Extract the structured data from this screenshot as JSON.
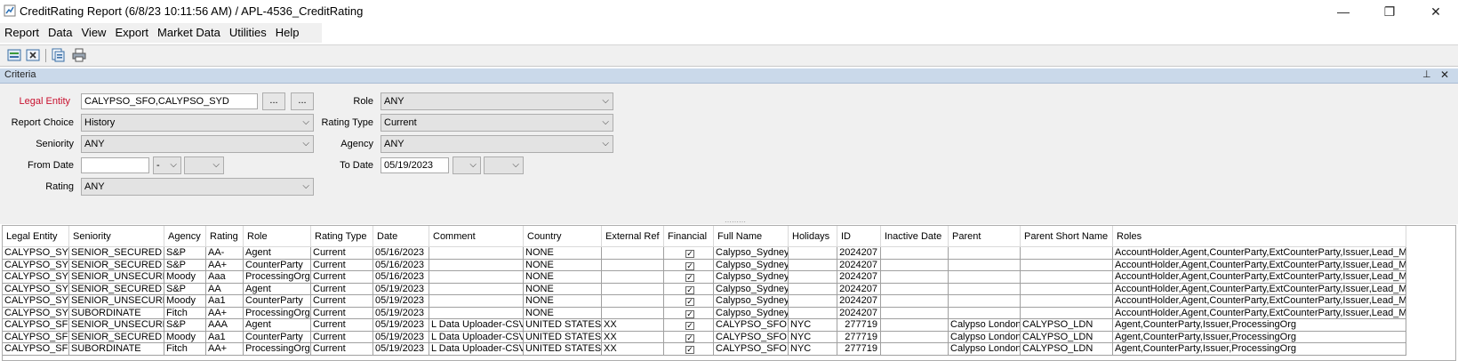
{
  "window": {
    "title": "CreditRating Report (6/8/23 10:11:56 AM) / APL-4536_CreditRating",
    "minimize": "—",
    "maximize": "❐",
    "close": "✕"
  },
  "menu": [
    "Report",
    "Data",
    "View",
    "Export",
    "Market Data",
    "Utilities",
    "Help"
  ],
  "toolbar": {
    "icons": [
      "load-report-icon",
      "clear-report-icon",
      "save-report-icon",
      "print-icon"
    ]
  },
  "criteria": {
    "title": "Criteria",
    "pin": "⊥",
    "close": "✕",
    "legal_entity": {
      "label": "Legal Entity",
      "value": "CALYPSO_SFO,CALYPSO_SYD",
      "btn1": "...",
      "btn2": "..."
    },
    "report_choice": {
      "label": "Report Choice",
      "value": "History"
    },
    "seniority": {
      "label": "Seniority",
      "value": "ANY"
    },
    "from_date": {
      "label": "From Date",
      "value": "",
      "combo1": "-",
      "combo2": ""
    },
    "rating": {
      "label": "Rating",
      "value": "ANY"
    },
    "role": {
      "label": "Role",
      "value": "ANY"
    },
    "rating_type": {
      "label": "Rating Type",
      "value": "Current"
    },
    "agency": {
      "label": "Agency",
      "value": "ANY"
    },
    "to_date": {
      "label": "To Date",
      "value": "05/19/2023",
      "combo1": "",
      "combo2": ""
    },
    "arrow": "⌵"
  },
  "grid": {
    "columns": [
      "Legal Entity",
      "Seniority",
      "Agency",
      "Rating",
      "Role",
      "Rating Type",
      "Date",
      "Comment",
      "Country",
      "External Ref",
      "Financial",
      "Full Name",
      "Holidays",
      "ID",
      "Inactive Date",
      "Parent",
      "Parent Short Name",
      "Roles"
    ],
    "rows": [
      [
        "CALYPSO_SYD",
        "SENIOR_SECURED",
        "S&P",
        "AA-",
        "Agent",
        "Current",
        "05/16/2023",
        "",
        "NONE",
        "",
        "✓",
        "Calypso_Sydney",
        "",
        "2024207",
        "",
        "",
        "",
        "AccountHolder,Agent,CounterParty,ExtCounterParty,Issuer,Lead_Ma"
      ],
      [
        "CALYPSO_SYD",
        "SENIOR_SECURED",
        "S&P",
        "AA+",
        "CounterParty",
        "Current",
        "05/16/2023",
        "",
        "NONE",
        "",
        "✓",
        "Calypso_Sydney",
        "",
        "2024207",
        "",
        "",
        "",
        "AccountHolder,Agent,CounterParty,ExtCounterParty,Issuer,Lead_Ma"
      ],
      [
        "CALYPSO_SYD",
        "SENIOR_UNSECURED",
        "Moody",
        "Aaa",
        "ProcessingOrg",
        "Current",
        "05/16/2023",
        "",
        "NONE",
        "",
        "✓",
        "Calypso_Sydney",
        "",
        "2024207",
        "",
        "",
        "",
        "AccountHolder,Agent,CounterParty,ExtCounterParty,Issuer,Lead_Ma"
      ],
      [
        "CALYPSO_SYD",
        "SENIOR_SECURED",
        "S&P",
        "AA",
        "Agent",
        "Current",
        "05/19/2023",
        "",
        "NONE",
        "",
        "✓",
        "Calypso_Sydney",
        "",
        "2024207",
        "",
        "",
        "",
        "AccountHolder,Agent,CounterParty,ExtCounterParty,Issuer,Lead_Ma"
      ],
      [
        "CALYPSO_SYD",
        "SENIOR_UNSECURED",
        "Moody",
        "Aa1",
        "CounterParty",
        "Current",
        "05/19/2023",
        "",
        "NONE",
        "",
        "✓",
        "Calypso_Sydney",
        "",
        "2024207",
        "",
        "",
        "",
        "AccountHolder,Agent,CounterParty,ExtCounterParty,Issuer,Lead_Ma"
      ],
      [
        "CALYPSO_SYD",
        "SUBORDINATE",
        "Fitch",
        "AA+",
        "ProcessingOrg",
        "Current",
        "05/19/2023",
        "",
        "NONE",
        "",
        "✓",
        "Calypso_Sydney",
        "",
        "2024207",
        "",
        "",
        "",
        "AccountHolder,Agent,CounterParty,ExtCounterParty,Issuer,Lead_Ma"
      ],
      [
        "CALYPSO_SFO",
        "SENIOR_UNSECURED",
        "S&P",
        "AAA",
        "Agent",
        "Current",
        "05/19/2023",
        "L Data Uploader-CSV",
        "UNITED STATES",
        "XX",
        "✓",
        "CALYPSO_SFO",
        "NYC",
        "277719",
        "",
        "Calypso London",
        "CALYPSO_LDN",
        "Agent,CounterParty,Issuer,ProcessingOrg"
      ],
      [
        "CALYPSO_SFO",
        "SENIOR_SECURED",
        "Moody",
        "Aa1",
        "CounterParty",
        "Current",
        "05/19/2023",
        "L Data Uploader-CSV",
        "UNITED STATES",
        "XX",
        "✓",
        "CALYPSO_SFO",
        "NYC",
        "277719",
        "",
        "Calypso London",
        "CALYPSO_LDN",
        "Agent,CounterParty,Issuer,ProcessingOrg"
      ],
      [
        "CALYPSO_SFO",
        "SUBORDINATE",
        "Fitch",
        "AA+",
        "ProcessingOrg",
        "Current",
        "05/19/2023",
        "L Data Uploader-CSV",
        "UNITED STATES",
        "XX",
        "✓",
        "CALYPSO_SFO",
        "NYC",
        "277719",
        "",
        "Calypso London",
        "CALYPSO_LDN",
        "Agent,CounterParty,Issuer,ProcessingOrg"
      ]
    ]
  }
}
